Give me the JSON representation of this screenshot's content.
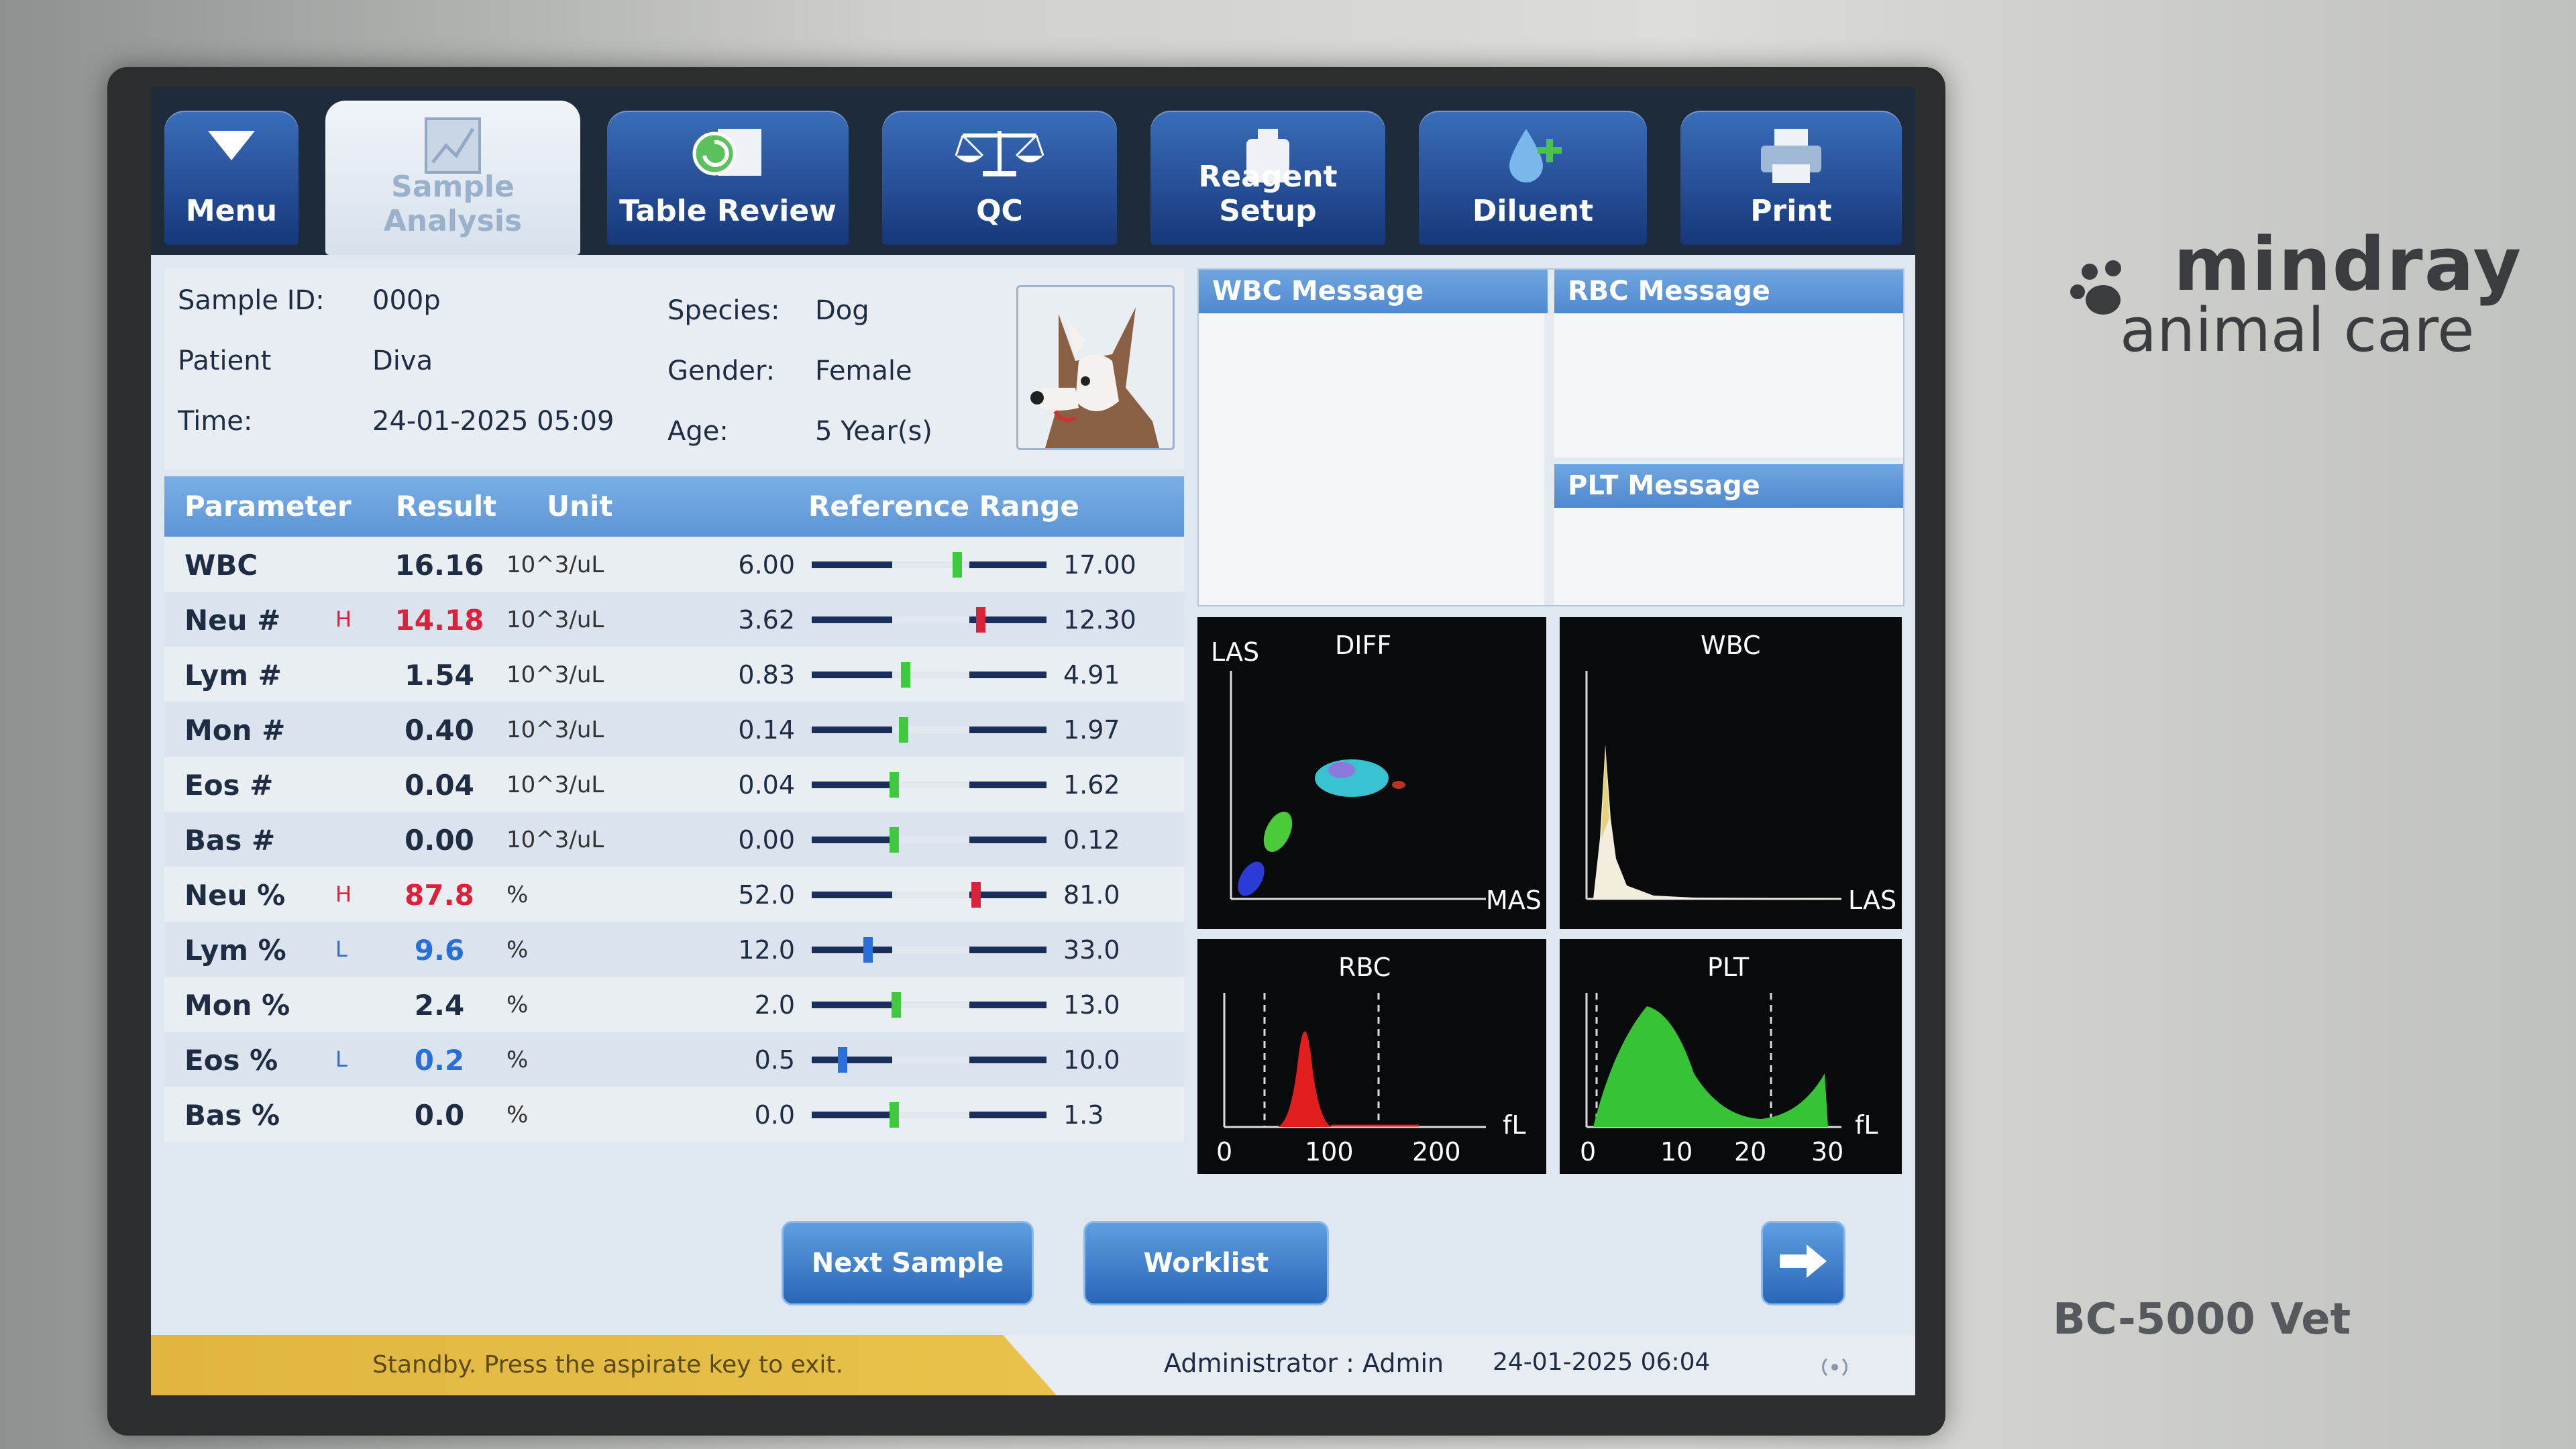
{
  "tabs": [
    {
      "label": "Menu",
      "icon": "triangle-down-icon"
    },
    {
      "label": "Sample Analysis",
      "icon": "chart-icon",
      "active": true
    },
    {
      "label": "Table Review",
      "icon": "review-icon"
    },
    {
      "label": "QC",
      "icon": "scale-icon"
    },
    {
      "label": "Reagent Setup",
      "icon": "bottle-icon"
    },
    {
      "label": "Diluent",
      "icon": "droplet-icon"
    },
    {
      "label": "Print",
      "icon": "printer-icon"
    }
  ],
  "sample": {
    "id_label": "Sample ID:",
    "id": "000p",
    "patient_label": "Patient",
    "patient": "Diva",
    "time_label": "Time:",
    "time": "24-01-2025 05:09",
    "species_label": "Species:",
    "species": "Dog",
    "gender_label": "Gender:",
    "gender": "Female",
    "age_label": "Age:",
    "age": "5 Year(s)"
  },
  "table": {
    "headers": {
      "parameter": "Parameter",
      "result": "Result",
      "unit": "Unit",
      "range": "Reference Range"
    },
    "rows": [
      {
        "param": "WBC",
        "flag": "",
        "result": "16.16",
        "unit": "10^3/uL",
        "low": "6.00",
        "high": "17.00",
        "level": 0.62,
        "status": "normal"
      },
      {
        "param": "Neu #",
        "flag": "H",
        "result": "14.18",
        "unit": "10^3/uL",
        "low": "3.62",
        "high": "12.30",
        "level": 0.72,
        "status": "high"
      },
      {
        "param": "Lym #",
        "flag": "",
        "result": "1.54",
        "unit": "10^3/uL",
        "low": "0.83",
        "high": "4.91",
        "level": 0.4,
        "status": "normal"
      },
      {
        "param": "Mon #",
        "flag": "",
        "result": "0.40",
        "unit": "10^3/uL",
        "low": "0.14",
        "high": "1.97",
        "level": 0.39,
        "status": "normal"
      },
      {
        "param": "Eos #",
        "flag": "",
        "result": "0.04",
        "unit": "10^3/uL",
        "low": "0.04",
        "high": "1.62",
        "level": 0.35,
        "status": "normal"
      },
      {
        "param": "Bas #",
        "flag": "",
        "result": "0.00",
        "unit": "10^3/uL",
        "low": "0.00",
        "high": "0.12",
        "level": 0.35,
        "status": "normal"
      },
      {
        "param": "Neu %",
        "flag": "H",
        "result": "87.8",
        "unit": "%",
        "low": "52.0",
        "high": "81.0",
        "level": 0.7,
        "status": "high"
      },
      {
        "param": "Lym %",
        "flag": "L",
        "result": "9.6",
        "unit": "%",
        "low": "12.0",
        "high": "33.0",
        "level": 0.24,
        "status": "low"
      },
      {
        "param": "Mon %",
        "flag": "",
        "result": "2.4",
        "unit": "%",
        "low": "2.0",
        "high": "13.0",
        "level": 0.36,
        "status": "normal"
      },
      {
        "param": "Eos %",
        "flag": "L",
        "result": "0.2",
        "unit": "%",
        "low": "0.5",
        "high": "10.0",
        "level": 0.13,
        "status": "low"
      },
      {
        "param": "Bas %",
        "flag": "",
        "result": "0.0",
        "unit": "%",
        "low": "0.0",
        "high": "1.3",
        "level": 0.35,
        "status": "normal"
      }
    ]
  },
  "messages": {
    "wbc": "WBC Message",
    "rbc": "RBC Message",
    "plt": "PLT Message"
  },
  "plots": {
    "diff": {
      "title": "DIFF",
      "y_label": "LAS",
      "x_label": "MAS"
    },
    "wbc": {
      "title": "WBC",
      "x_label": "LAS"
    },
    "rbc": {
      "title": "RBC",
      "unit": "fL",
      "ticks": [
        "0",
        "100",
        "200"
      ]
    },
    "plt": {
      "title": "PLT",
      "unit": "fL",
      "ticks": [
        "0",
        "10",
        "20",
        "30"
      ]
    }
  },
  "buttons": {
    "next": "Next Sample",
    "worklist": "Worklist",
    "arrow": "next-arrow-icon"
  },
  "status": {
    "message": "Standby. Press the aspirate key to exit.",
    "user": "Administrator : Admin",
    "datetime": "24-01-2025 06:04"
  },
  "brand": {
    "name": "mindray",
    "sub": "animal care",
    "model": "BC-5000 Vet"
  },
  "colors": {
    "normal_marker": "#3fc93f",
    "high_marker": "#d9233a",
    "low_marker": "#2a6ed8",
    "header_blue": "#5d95d6"
  }
}
